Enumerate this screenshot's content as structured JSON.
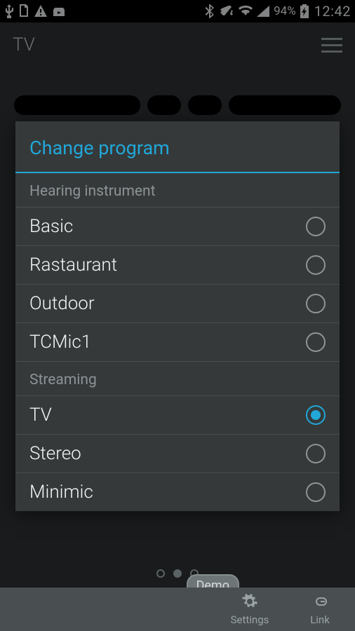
{
  "status": {
    "battery": "94%",
    "clock": "12:42"
  },
  "app": {
    "title": "TV"
  },
  "dialog": {
    "title": "Change program",
    "sections": [
      {
        "header": "Hearing instrument",
        "items": [
          {
            "label": "Basic",
            "selected": false
          },
          {
            "label": "Rastaurant",
            "selected": false
          },
          {
            "label": "Outdoor",
            "selected": false
          },
          {
            "label": "TCMic1",
            "selected": false
          }
        ]
      },
      {
        "header": "Streaming",
        "items": [
          {
            "label": "TV",
            "selected": true
          },
          {
            "label": "Stereo",
            "selected": false
          },
          {
            "label": "Minimic",
            "selected": false
          }
        ]
      }
    ]
  },
  "bottom": {
    "demo": "Demo",
    "settings": "Settings",
    "link": "Link"
  }
}
